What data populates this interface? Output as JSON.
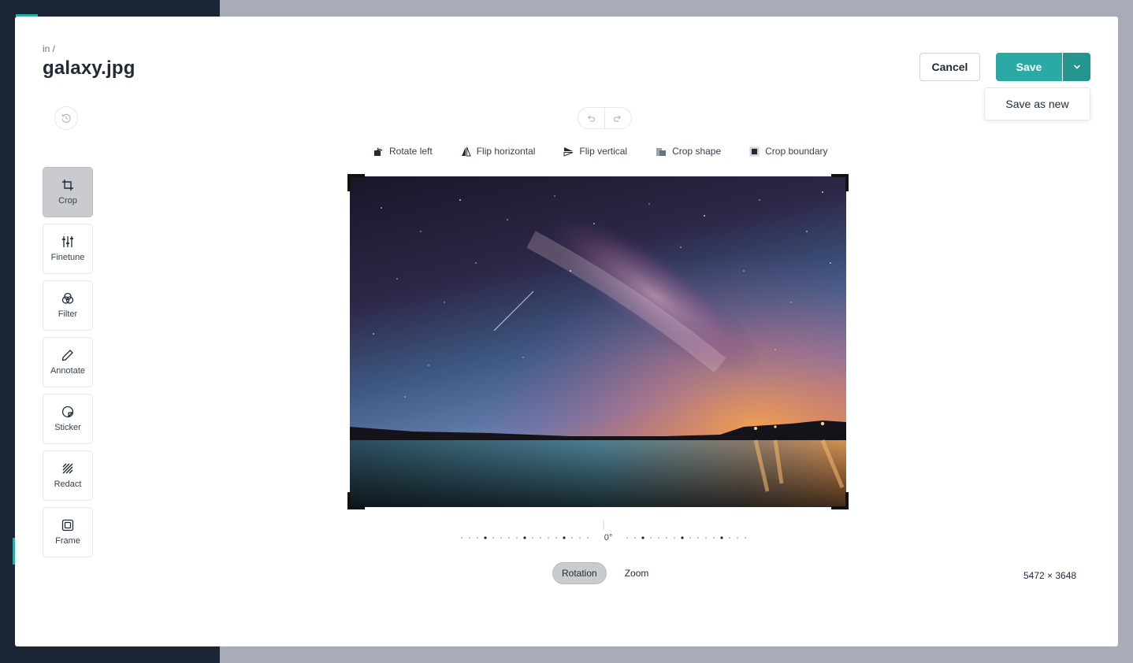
{
  "header": {
    "breadcrumb": "in /",
    "title": "galaxy.jpg"
  },
  "actions": {
    "cancel_label": "Cancel",
    "save_label": "Save",
    "save_as_new_label": "Save as new"
  },
  "crop_toolbar": {
    "items": [
      {
        "label": "Rotate left",
        "icon": "rotate-left-icon"
      },
      {
        "label": "Flip horizontal",
        "icon": "flip-horizontal-icon"
      },
      {
        "label": "Flip vertical",
        "icon": "flip-vertical-icon"
      },
      {
        "label": "Crop shape",
        "icon": "crop-shape-icon"
      },
      {
        "label": "Crop boundary",
        "icon": "crop-boundary-icon"
      }
    ]
  },
  "tools": {
    "items": [
      {
        "label": "Crop",
        "icon": "crop-icon",
        "active": true
      },
      {
        "label": "Finetune",
        "icon": "sliders-icon"
      },
      {
        "label": "Filter",
        "icon": "filter-icon"
      },
      {
        "label": "Annotate",
        "icon": "pencil-icon"
      },
      {
        "label": "Sticker",
        "icon": "sticker-icon"
      },
      {
        "label": "Redact",
        "icon": "redact-icon"
      },
      {
        "label": "Frame",
        "icon": "frame-icon"
      }
    ]
  },
  "rotation": {
    "value_label": "0°"
  },
  "modes": {
    "rotation_label": "Rotation",
    "zoom_label": "Zoom",
    "active": "Rotation"
  },
  "image": {
    "dimensions": "5472 × 3648"
  },
  "colors": {
    "accent": "#2aa9a5",
    "accent_dark": "#26958f",
    "active_tool": "#c9cbcf"
  }
}
